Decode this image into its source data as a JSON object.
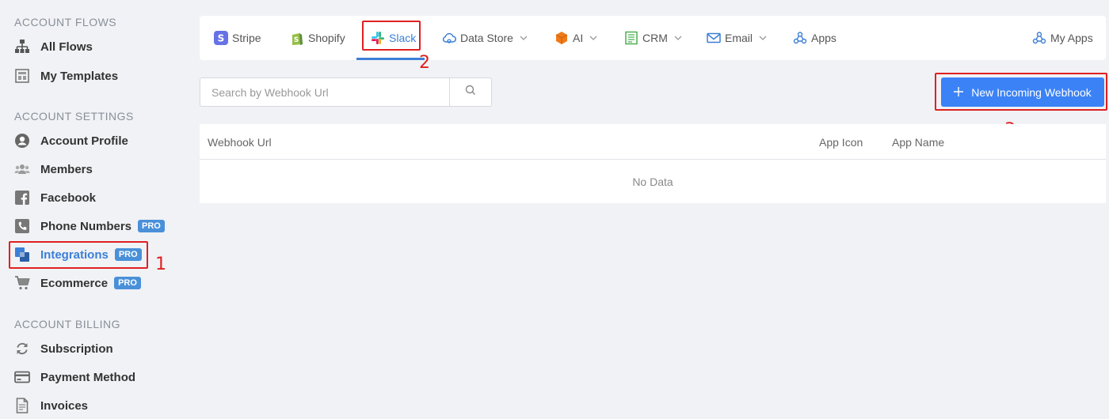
{
  "sidebar": {
    "sections": [
      {
        "title": "ACCOUNT FLOWS"
      },
      {
        "title": "ACCOUNT SETTINGS"
      },
      {
        "title": "ACCOUNT BILLING"
      }
    ],
    "items": [
      {
        "label": "All Flows",
        "icon": "sitemap-icon"
      },
      {
        "label": "My Templates",
        "icon": "template-icon"
      },
      {
        "label": "Account Profile",
        "icon": "user-circle-icon"
      },
      {
        "label": "Members",
        "icon": "users-icon"
      },
      {
        "label": "Facebook",
        "icon": "facebook-icon"
      },
      {
        "label": "Phone Numbers",
        "icon": "phone-icon",
        "badge": "PRO"
      },
      {
        "label": "Integrations",
        "icon": "integrations-icon",
        "badge": "PRO",
        "active": true
      },
      {
        "label": "Ecommerce",
        "icon": "cart-icon",
        "badge": "PRO"
      },
      {
        "label": "Subscription",
        "icon": "refresh-icon"
      },
      {
        "label": "Payment Method",
        "icon": "credit-card-icon"
      },
      {
        "label": "Invoices",
        "icon": "invoice-icon"
      }
    ]
  },
  "tabs": [
    {
      "label": "Stripe",
      "icon": "stripe-icon"
    },
    {
      "label": "Shopify",
      "icon": "shopify-icon"
    },
    {
      "label": "Slack",
      "icon": "slack-icon",
      "active": true
    },
    {
      "label": "Data Store",
      "icon": "cloud-icon",
      "dropdown": true
    },
    {
      "label": "AI",
      "icon": "cube-icon",
      "dropdown": true
    },
    {
      "label": "CRM",
      "icon": "crm-icon",
      "dropdown": true
    },
    {
      "label": "Email",
      "icon": "email-icon",
      "dropdown": true
    },
    {
      "label": "Apps",
      "icon": "webhook-icon"
    },
    {
      "label": "My Apps",
      "icon": "webhook-icon"
    }
  ],
  "search": {
    "placeholder": "Search by Webhook Url",
    "value": ""
  },
  "new_button": {
    "label": "New Incoming Webhook"
  },
  "table": {
    "columns": [
      "Webhook Url",
      "App Icon",
      "App Name"
    ],
    "empty_text": "No Data"
  },
  "annotations": [
    "1",
    "2",
    "3"
  ],
  "colors": {
    "accent": "#3b7fd8",
    "button": "#3b82f6",
    "annotation": "#e02020",
    "badge": "#4a90d9"
  }
}
